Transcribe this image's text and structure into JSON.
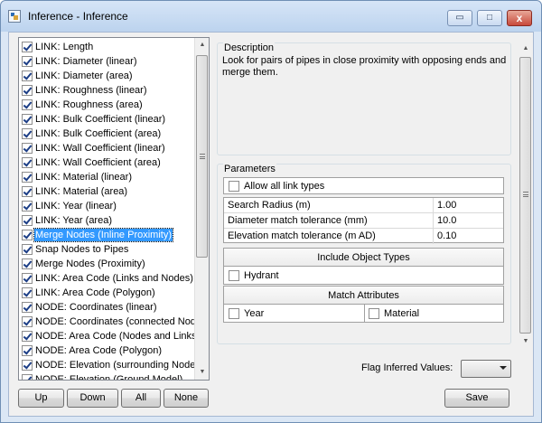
{
  "window": {
    "title": "Inference - Inference",
    "controls": {
      "minimize": "▭",
      "maximize": "□",
      "close": "x"
    }
  },
  "inference_list": {
    "items": [
      {
        "label": "LINK: Length",
        "checked": true
      },
      {
        "label": "LINK: Diameter (linear)",
        "checked": true
      },
      {
        "label": "LINK: Diameter (area)",
        "checked": true
      },
      {
        "label": "LINK: Roughness (linear)",
        "checked": true
      },
      {
        "label": "LINK: Roughness (area)",
        "checked": true
      },
      {
        "label": "LINK: Bulk Coefficient (linear)",
        "checked": true
      },
      {
        "label": "LINK: Bulk Coefficient (area)",
        "checked": true
      },
      {
        "label": "LINK: Wall Coefficient (linear)",
        "checked": true
      },
      {
        "label": "LINK: Wall Coefficient (area)",
        "checked": true
      },
      {
        "label": "LINK: Material (linear)",
        "checked": true
      },
      {
        "label": "LINK: Material (area)",
        "checked": true
      },
      {
        "label": "LINK: Year (linear)",
        "checked": true
      },
      {
        "label": "LINK: Year (area)",
        "checked": true
      },
      {
        "label": "Merge Nodes (Inline Proximity)",
        "checked": true,
        "selected": true
      },
      {
        "label": "Snap Nodes to Pipes",
        "checked": true
      },
      {
        "label": "Merge Nodes (Proximity)",
        "checked": true
      },
      {
        "label": "LINK: Area Code (Links and Nodes)",
        "checked": true
      },
      {
        "label": "LINK: Area Code (Polygon)",
        "checked": true
      },
      {
        "label": "NODE: Coordinates (linear)",
        "checked": true
      },
      {
        "label": "NODE: Coordinates (connected Nodes)",
        "checked": true
      },
      {
        "label": "NODE: Area Code (Nodes and Links)",
        "checked": true
      },
      {
        "label": "NODE: Area Code (Polygon)",
        "checked": true
      },
      {
        "label": "NODE: Elevation (surrounding Nodes)",
        "checked": true
      },
      {
        "label": "NODE: Elevation (Ground Model)",
        "checked": true
      }
    ]
  },
  "list_buttons": {
    "up": "Up",
    "down": "Down",
    "all": "All",
    "none": "None"
  },
  "description": {
    "title": "Description",
    "text": "Look for pairs of pipes in close proximity with opposing ends and merge them."
  },
  "parameters": {
    "title": "Parameters",
    "allow_all_link_types": {
      "label": "Allow all link types",
      "checked": false
    },
    "rows": [
      {
        "name": "Search Radius (m)",
        "value": "1.00"
      },
      {
        "name": "Diameter match tolerance (mm)",
        "value": "10.0"
      },
      {
        "name": "Elevation match tolerance (m AD)",
        "value": "0.10"
      }
    ],
    "include_object_types": {
      "header": "Include Object Types",
      "items": [
        {
          "label": "Hydrant",
          "checked": false
        }
      ]
    },
    "match_attributes": {
      "header": "Match Attributes",
      "items": [
        {
          "label": "Year",
          "checked": false
        },
        {
          "label": "Material",
          "checked": false
        }
      ]
    }
  },
  "flag_inferred_values": {
    "label": "Flag Inferred Values:",
    "value": ""
  },
  "save_button": "Save"
}
